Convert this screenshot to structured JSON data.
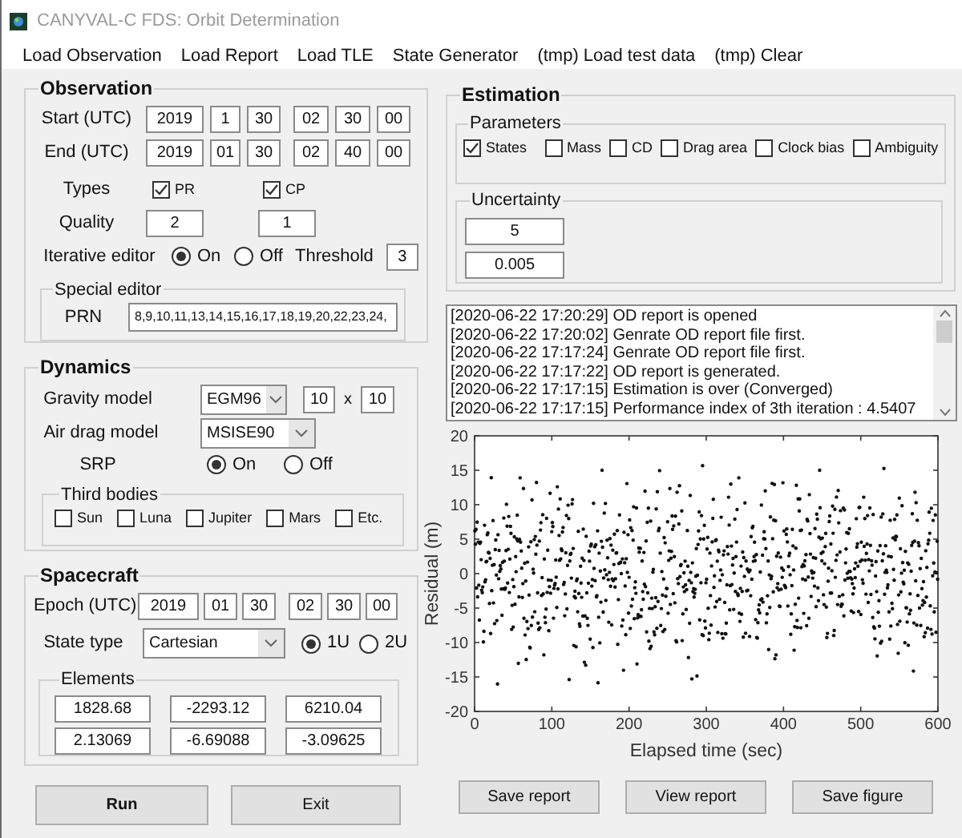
{
  "window": {
    "title": "CANYVAL-C FDS: Orbit Determination"
  },
  "menu": [
    "Load Observation",
    "Load Report",
    "Load TLE",
    "State Generator",
    "(tmp) Load test data",
    "(tmp) Clear"
  ],
  "observation": {
    "title": "Observation",
    "start": {
      "label": "Start (UTC)",
      "values": [
        "2019",
        "1",
        "30",
        "02",
        "30",
        "00"
      ]
    },
    "end": {
      "label": "End (UTC)",
      "values": [
        "2019",
        "01",
        "30",
        "02",
        "40",
        "00"
      ]
    },
    "types": {
      "label": "Types",
      "options": [
        {
          "label": "PR",
          "checked": true
        },
        {
          "label": "CP",
          "checked": true
        }
      ]
    },
    "quality": {
      "label": "Quality",
      "values": [
        "2",
        "1"
      ]
    },
    "iterative_editor": {
      "label": "Iterative editor",
      "options": [
        {
          "label": "On",
          "selected": true
        },
        {
          "label": "Off",
          "selected": false
        }
      ]
    },
    "threshold": {
      "label": "Threshold",
      "value": "3"
    },
    "special_editor": {
      "title": "Special editor",
      "prn_label": "PRN",
      "prn_value": "8,9,10,11,13,14,15,16,17,18,19,20,22,23,24,"
    }
  },
  "dynamics": {
    "title": "Dynamics",
    "gravity": {
      "label": "Gravity model",
      "value": "EGM96",
      "degree": "10",
      "separator": "x",
      "order": "10"
    },
    "air_drag": {
      "label": "Air drag model",
      "value": "MSISE90"
    },
    "srp": {
      "label": "SRP",
      "options": [
        {
          "label": "On",
          "selected": true
        },
        {
          "label": "Off",
          "selected": false
        }
      ]
    },
    "third_bodies": {
      "title": "Third bodies",
      "options": [
        {
          "label": "Sun",
          "checked": false
        },
        {
          "label": "Luna",
          "checked": false
        },
        {
          "label": "Jupiter",
          "checked": false
        },
        {
          "label": "Mars",
          "checked": false
        },
        {
          "label": "Etc.",
          "checked": false
        }
      ]
    }
  },
  "spacecraft": {
    "title": "Spacecraft",
    "epoch": {
      "label": "Epoch (UTC)",
      "values": [
        "2019",
        "01",
        "30",
        "02",
        "30",
        "00"
      ]
    },
    "state_type": {
      "label": "State type",
      "value": "Cartesian",
      "options": [
        {
          "label": "1U",
          "selected": true
        },
        {
          "label": "2U",
          "selected": false
        }
      ]
    },
    "elements": {
      "title": "Elements",
      "values": [
        "1828.68",
        "-2293.12",
        "6210.04",
        "2.13069",
        "-6.69088",
        "-3.09625"
      ]
    }
  },
  "left_buttons": [
    "Run",
    "Exit"
  ],
  "estimation": {
    "title": "Estimation",
    "parameters": {
      "title": "Parameters",
      "options": [
        {
          "label": "States",
          "checked": true
        },
        {
          "label": "Mass",
          "checked": false
        },
        {
          "label": "CD",
          "checked": false
        },
        {
          "label": "Drag area",
          "checked": false
        },
        {
          "label": "Clock bias",
          "checked": false
        },
        {
          "label": "Ambiguity",
          "checked": false
        }
      ]
    },
    "uncertainty": {
      "title": "Uncertainty",
      "values": [
        "5",
        "0.005"
      ]
    }
  },
  "log": [
    "[2020-06-22 17:20:29] OD report is opened",
    "[2020-06-22 17:20:02] Genrate OD report file first.",
    "[2020-06-22 17:17:24] Genrate OD report file first.",
    "[2020-06-22 17:17:22] OD report is generated.",
    "[2020-06-22 17:17:15] Estimation is over (Converged)",
    "[2020-06-22 17:17:15] Performance index of 3th iteration : 4.5407"
  ],
  "plot": {
    "chart_data": {
      "type": "scatter",
      "xlabel": "Elapsed time (sec)",
      "ylabel": "Residual (m)",
      "xlim": [
        0,
        600
      ],
      "ylim": [
        -20,
        20
      ],
      "xticks": [
        0,
        100,
        200,
        300,
        400,
        500,
        600
      ],
      "yticks": [
        -20,
        -15,
        -10,
        -5,
        0,
        5,
        10,
        15,
        20
      ]
    }
  },
  "right_buttons": [
    "Save report",
    "View report",
    "Save figure"
  ]
}
